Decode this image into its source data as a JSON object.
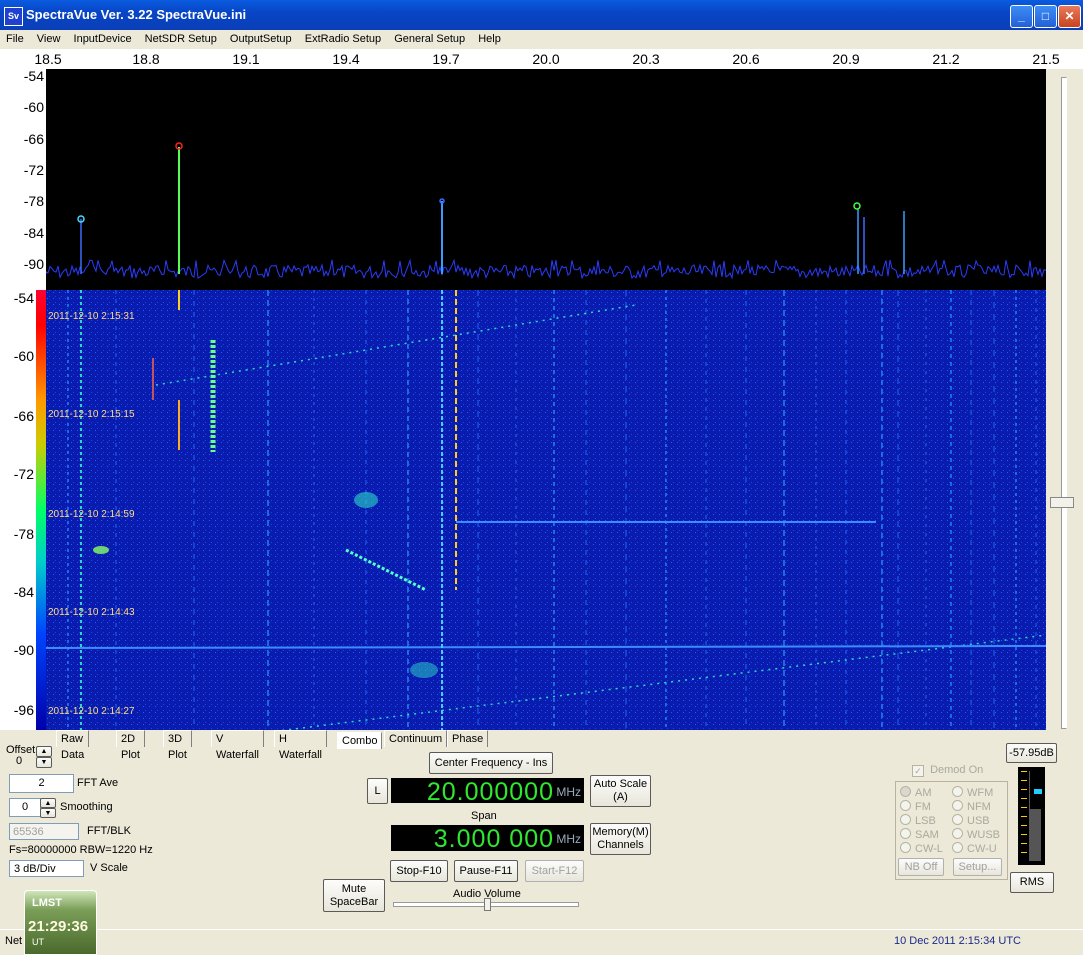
{
  "window": {
    "title": "SpectraVue Ver. 3.22 SpectraVue.ini",
    "icon_text": "Sv",
    "minimize": "_",
    "maximize": "□",
    "close": "✕"
  },
  "menu": [
    "File",
    "View",
    "InputDevice",
    "NetSDR Setup",
    "OutputSetup",
    "ExtRadio Setup",
    "General Setup",
    "Help"
  ],
  "freq_axis": [
    "18.5",
    "18.8",
    "19.1",
    "19.4",
    "19.7",
    "20.0",
    "20.3",
    "20.6",
    "20.9",
    "21.2",
    "21.5"
  ],
  "spectrum_axis": [
    "-54",
    "-60",
    "-66",
    "-72",
    "-78",
    "-84",
    "-90"
  ],
  "waterfall_axis": [
    "-54",
    "-60",
    "-66",
    "-72",
    "-78",
    "-84",
    "-90",
    "-96"
  ],
  "waterfall_timestamps": [
    "2011-12-10 2:15:31",
    "2011-12-10 2:15:15",
    "2011-12-10 2:14:59",
    "2011-12-10 2:14:43",
    "2011-12-10 2:14:27"
  ],
  "tabs": [
    "Raw Data",
    "2D Plot",
    "3D Plot",
    "V Waterfall",
    "H Waterfall",
    "Combo",
    "Continuum",
    "Phase"
  ],
  "active_tab": "Combo",
  "offset": {
    "label": "Offset",
    "value": "0"
  },
  "fft_ave": {
    "label": "FFT Ave",
    "value": "2"
  },
  "smoothing": {
    "label": "Smoothing",
    "value": "0"
  },
  "fft_blk": {
    "label": "FFT/BLK",
    "value": "65536"
  },
  "fs_rbw": "Fs=80000000 RBW=1220 Hz",
  "vscale": {
    "label": "V Scale",
    "value": "3 dB/Div"
  },
  "center_freq_button": "Center Frequency - Ins",
  "lock_button": "L",
  "center_freq": {
    "value": "20.000000",
    "unit": "MHz"
  },
  "span": {
    "label": "Span",
    "value": "3.000 000",
    "unit": "MHz"
  },
  "auto_scale_button": "Auto Scale (A)",
  "memory_button": "Memory(M) Channels",
  "stop_button": "Stop-F10",
  "pause_button": "Pause-F11",
  "start_button": "Start-F12",
  "mute_button": "Mute SpaceBar",
  "audio_volume": {
    "label": "Audio Volume",
    "level": 0.5
  },
  "level_readout": "-57.95dB",
  "demod": {
    "label": "Demod On",
    "checked": true
  },
  "modes_left": [
    "AM",
    "FM",
    "LSB",
    "SAM",
    "CW-L"
  ],
  "modes_right": [
    "WFM",
    "NFM",
    "USB",
    "WUSB",
    "CW-U"
  ],
  "selected_mode": "AM",
  "nb_button": "NB Off",
  "setup_button": "Setup...",
  "rms_button": "RMS",
  "status": {
    "left": "Net",
    "datetime": "10 Dec 2011  2:15:34 UTC"
  },
  "clock": {
    "title": "LMST",
    "time": "21:29:36",
    "ut_label": "UT"
  },
  "colors": {
    "titlebar": "#0845c6",
    "spectrum_bg": "#000000",
    "waterfall_bg": "#0818a8",
    "lcd_text": "#2fe82f"
  }
}
